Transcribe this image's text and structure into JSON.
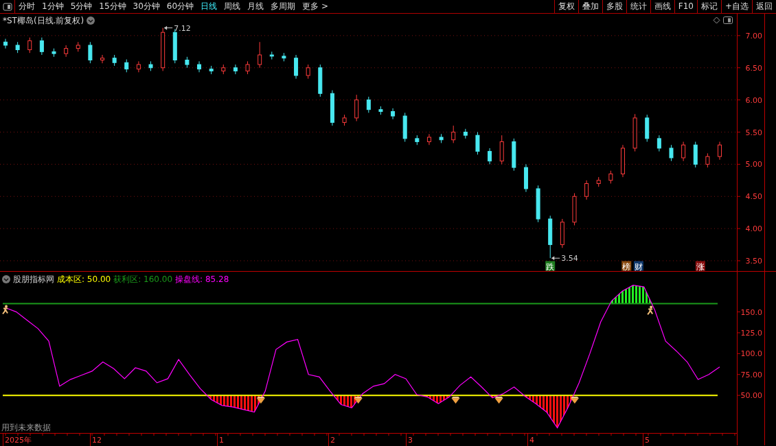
{
  "toolbar": {
    "tabs": [
      {
        "label": "分时",
        "selected": false
      },
      {
        "label": "1分钟",
        "selected": false
      },
      {
        "label": "5分钟",
        "selected": false
      },
      {
        "label": "15分钟",
        "selected": false
      },
      {
        "label": "30分钟",
        "selected": false
      },
      {
        "label": "60分钟",
        "selected": false
      },
      {
        "label": "日线",
        "selected": true
      },
      {
        "label": "周线",
        "selected": false
      },
      {
        "label": "月线",
        "selected": false
      },
      {
        "label": "多周期",
        "selected": false
      },
      {
        "label": "更多 >",
        "selected": false
      }
    ],
    "buttons": [
      "复权",
      "叠加",
      "多股",
      "统计",
      "画线",
      "F10",
      "标记",
      "+自选",
      "返回"
    ]
  },
  "price_chart": {
    "title": "*ST椰岛(日线.前复权)",
    "tags": [
      {
        "color": "#1e7d1e"
      },
      {
        "color": "#8a4a10"
      },
      {
        "color": "#123a6e"
      },
      {
        "color": "#8a0f0f"
      }
    ],
    "chart_data": {
      "type": "candlestick",
      "grid": true,
      "ohlc": [
        [
          6.9,
          6.95,
          6.8,
          6.85
        ],
        [
          6.85,
          6.9,
          6.73,
          6.78
        ],
        [
          6.78,
          6.97,
          6.73,
          6.92
        ],
        [
          6.92,
          6.97,
          6.7,
          6.75
        ],
        [
          6.75,
          6.8,
          6.67,
          6.72
        ],
        [
          6.72,
          6.85,
          6.67,
          6.8
        ],
        [
          6.8,
          6.9,
          6.75,
          6.85
        ],
        [
          6.85,
          6.9,
          6.57,
          6.62
        ],
        [
          6.62,
          6.7,
          6.57,
          6.65
        ],
        [
          6.65,
          6.7,
          6.53,
          6.58
        ],
        [
          6.58,
          6.63,
          6.43,
          6.48
        ],
        [
          6.48,
          6.6,
          6.43,
          6.55
        ],
        [
          6.55,
          6.6,
          6.45,
          6.5
        ],
        [
          6.5,
          7.12,
          6.45,
          7.05
        ],
        [
          7.05,
          7.1,
          6.57,
          6.62
        ],
        [
          6.62,
          6.67,
          6.5,
          6.55
        ],
        [
          6.55,
          6.6,
          6.43,
          6.48
        ],
        [
          6.48,
          6.53,
          6.4,
          6.45
        ],
        [
          6.45,
          6.55,
          6.4,
          6.5
        ],
        [
          6.5,
          6.55,
          6.4,
          6.45
        ],
        [
          6.45,
          6.6,
          6.4,
          6.55
        ],
        [
          6.55,
          6.9,
          6.5,
          6.7
        ],
        [
          6.7,
          6.75,
          6.63,
          6.68
        ],
        [
          6.68,
          6.73,
          6.6,
          6.65
        ],
        [
          6.65,
          6.7,
          6.33,
          6.38
        ],
        [
          6.38,
          6.55,
          6.33,
          6.5
        ],
        [
          6.5,
          6.55,
          6.05,
          6.1
        ],
        [
          6.1,
          6.15,
          5.6,
          5.65
        ],
        [
          5.65,
          5.77,
          5.6,
          5.72
        ],
        [
          5.72,
          6.08,
          5.67,
          6.0
        ],
        [
          6.0,
          6.05,
          5.8,
          5.85
        ],
        [
          5.85,
          5.9,
          5.77,
          5.82
        ],
        [
          5.82,
          5.87,
          5.7,
          5.75
        ],
        [
          5.75,
          5.8,
          5.35,
          5.4
        ],
        [
          5.4,
          5.45,
          5.3,
          5.35
        ],
        [
          5.35,
          5.47,
          5.3,
          5.42
        ],
        [
          5.42,
          5.47,
          5.33,
          5.38
        ],
        [
          5.38,
          5.6,
          5.33,
          5.5
        ],
        [
          5.5,
          5.55,
          5.4,
          5.45
        ],
        [
          5.45,
          5.5,
          5.15,
          5.2
        ],
        [
          5.2,
          5.25,
          5.0,
          5.05
        ],
        [
          5.05,
          5.45,
          5.0,
          5.35
        ],
        [
          5.35,
          5.4,
          4.9,
          4.95
        ],
        [
          4.95,
          5.0,
          4.57,
          4.62
        ],
        [
          4.62,
          4.67,
          4.1,
          4.15
        ],
        [
          4.15,
          4.2,
          3.54,
          3.75
        ],
        [
          3.75,
          4.15,
          3.7,
          4.1
        ],
        [
          4.1,
          4.55,
          4.05,
          4.5
        ],
        [
          4.5,
          4.75,
          4.45,
          4.7
        ],
        [
          4.7,
          4.8,
          4.65,
          4.75
        ],
        [
          4.75,
          4.9,
          4.7,
          4.85
        ],
        [
          4.85,
          5.3,
          4.8,
          5.25
        ],
        [
          5.25,
          5.78,
          5.2,
          5.72
        ],
        [
          5.72,
          5.77,
          5.35,
          5.4
        ],
        [
          5.4,
          5.45,
          5.2,
          5.25
        ],
        [
          5.25,
          5.3,
          5.05,
          5.1
        ],
        [
          5.1,
          5.35,
          5.05,
          5.3
        ],
        [
          5.3,
          5.35,
          4.95,
          5.0
        ],
        [
          5.0,
          5.17,
          4.95,
          5.12
        ],
        [
          5.12,
          5.35,
          5.07,
          5.3
        ]
      ],
      "ylim": [
        3.34,
        7.34
      ],
      "yticks": [
        {
          "value": 7,
          "label": "7.00"
        },
        {
          "value": 6.5,
          "label": "6.50"
        },
        {
          "value": 6,
          "label": "6.00"
        },
        {
          "value": 5.5,
          "label": "5.50"
        },
        {
          "value": 5,
          "label": "5.00"
        },
        {
          "value": 4.5,
          "label": "4.50"
        },
        {
          "value": 4,
          "label": "4.00"
        },
        {
          "value": 3.5,
          "label": "3.50"
        }
      ],
      "annotations": [
        "7.12",
        "3.54",
        "跌",
        "榜",
        "财",
        "涨"
      ]
    }
  },
  "date_axis": [
    {
      "label": "2025年"
    },
    {
      "label": "12"
    },
    {
      "label": "1"
    },
    {
      "label": "2"
    },
    {
      "label": "3"
    },
    {
      "label": "4"
    },
    {
      "label": "5"
    }
  ],
  "indicator": {
    "name": "股朋指标网",
    "legend": [
      {
        "label": "成本区:",
        "value": "50.00",
        "color": "#ffff00"
      },
      {
        "label": "获利区:",
        "value": "160.00",
        "color": "#1a9a1a"
      }
    ],
    "line_value": "85.28",
    "note": "用到未来数据",
    "chart_data": {
      "type": "line",
      "series": [
        {
          "name": "操盘线:",
          "color": "#ff00ff",
          "values": [
            155,
            150,
            140,
            130,
            115,
            61,
            69,
            74,
            79,
            90,
            82,
            70,
            83,
            79,
            65,
            70,
            93,
            75,
            58,
            45,
            38,
            36,
            33,
            30,
            55,
            105,
            114,
            117,
            75,
            72,
            55,
            39,
            35,
            52,
            61,
            64,
            75,
            70,
            51,
            48,
            40,
            48,
            62,
            72,
            60,
            47,
            52,
            60,
            49,
            40,
            30,
            11,
            36,
            65,
            100,
            138,
            163,
            175,
            182,
            180,
            152,
            115,
            103,
            90,
            69,
            75,
            84
          ]
        }
      ],
      "ylim": [
        -9.9,
        199
      ],
      "yticks": [
        {
          "value": 150,
          "label": "150.0"
        },
        {
          "value": 125,
          "label": "125.0"
        },
        {
          "value": 100,
          "label": "100.0"
        },
        {
          "value": 75,
          "label": "75.00"
        },
        {
          "value": 50,
          "label": "50.00"
        }
      ],
      "ref_lines": [
        {
          "axis": "y",
          "value": 50,
          "color": "#ffff00"
        },
        {
          "axis": "y",
          "value": 160,
          "color": "#1a9a1a"
        }
      ]
    }
  }
}
